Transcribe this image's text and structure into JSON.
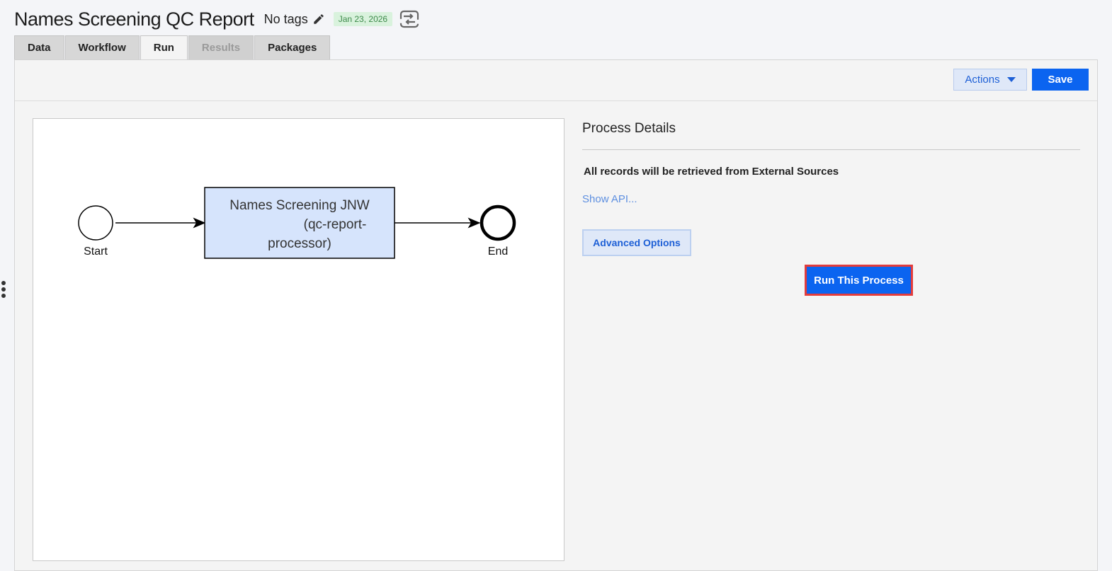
{
  "header": {
    "title": "Names Screening QC Report",
    "tags_label": "No tags",
    "date": "Jan 23, 2026"
  },
  "tabs": [
    {
      "label": "Data",
      "state": "normal"
    },
    {
      "label": "Workflow",
      "state": "normal"
    },
    {
      "label": "Run",
      "state": "active"
    },
    {
      "label": "Results",
      "state": "disabled"
    },
    {
      "label": "Packages",
      "state": "normal"
    }
  ],
  "toolbar": {
    "actions_label": "Actions",
    "save_label": "Save"
  },
  "diagram": {
    "start_label": "Start",
    "task_line1": "Names Screening JNW",
    "task_line2": "(qc-report-",
    "task_line3": "processor)",
    "end_label": "End"
  },
  "details": {
    "title": "Process Details",
    "records_note": "All records will be retrieved from External Sources",
    "show_api": "Show API...",
    "advanced_options": "Advanced Options",
    "run_button": "Run This Process"
  },
  "colors": {
    "primary": "#0b64f0",
    "secondary_bg": "#dfe8f8",
    "badge_bg": "#d9f2dd",
    "badge_text": "#3d8a4a",
    "task_fill": "#d6e4fc",
    "highlight_border": "#e23c3c",
    "link": "#5d8fe0"
  }
}
